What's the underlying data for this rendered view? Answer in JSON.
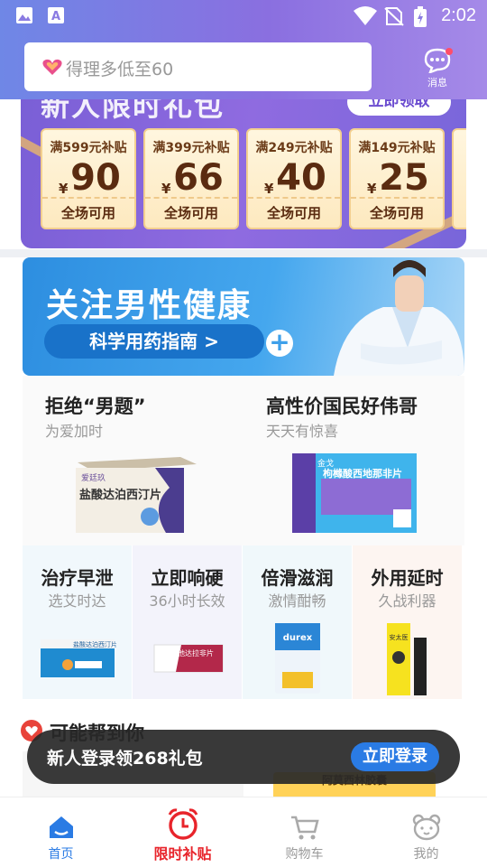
{
  "status_bar": {
    "time": "2:02",
    "icons": [
      "gallery-icon",
      "a-notification-icon",
      "wifi-icon",
      "no-sim-icon",
      "battery-icon"
    ]
  },
  "search": {
    "placeholder": "得理多低至60"
  },
  "message": {
    "label": "消息"
  },
  "new_user_banner": {
    "title": "新人限时礼包",
    "button": "立即领取",
    "coupons": [
      {
        "cond": "满599元补贴",
        "currency": "¥",
        "amount": "90",
        "scope": "全场可用"
      },
      {
        "cond": "满399元补贴",
        "currency": "¥",
        "amount": "66",
        "scope": "全场可用"
      },
      {
        "cond": "满249元补贴",
        "currency": "¥",
        "amount": "40",
        "scope": "全场可用"
      },
      {
        "cond": "满149元补贴",
        "currency": "¥",
        "amount": "25",
        "scope": "全场可用"
      }
    ]
  },
  "health_banner": {
    "title": "关注男性健康",
    "subtitle": "科学用药指南 >"
  },
  "products": [
    {
      "title": "拒绝“男题”",
      "subtitle": "为爱加时",
      "box_brand": "爱廷玖",
      "box_name": "盐酸达泊西汀片"
    },
    {
      "title": "高性价国民好伟哥",
      "subtitle": "天天有惊喜",
      "box_brand": "金戈",
      "box_name": "枸橼酸西地那非片"
    }
  ],
  "categories": [
    {
      "title": "治疗早泄",
      "subtitle": "选艾时达",
      "box": "盐酸达泊西汀片"
    },
    {
      "title": "立即响硬",
      "subtitle": "36小时长效",
      "box": "他达拉非片"
    },
    {
      "title": "倍滑滋润",
      "subtitle": "激情酣畅",
      "box": "durex"
    },
    {
      "title": "外用延时",
      "subtitle": "久战利器",
      "box": "安太医"
    }
  ],
  "maybe_help": {
    "label": "可能帮到你",
    "peek_label": "阿莫西林胶囊"
  },
  "toast": {
    "text": "新人登录领268礼包",
    "button": "立即登录"
  },
  "tabs": [
    {
      "label": "首页",
      "icon": "home-icon",
      "active": true
    },
    {
      "label": "限时补贴",
      "icon": "alarm-clock-icon",
      "active": false
    },
    {
      "label": "购物车",
      "icon": "cart-icon",
      "active": false
    },
    {
      "label": "我的",
      "icon": "bear-face-icon",
      "active": false
    }
  ],
  "colors": {
    "accent_blue": "#2a7be4",
    "header_start": "#6f87e6",
    "header_end": "#a58ae8",
    "tab_red": "#e8242b",
    "coupon_text": "#5a2b10"
  }
}
